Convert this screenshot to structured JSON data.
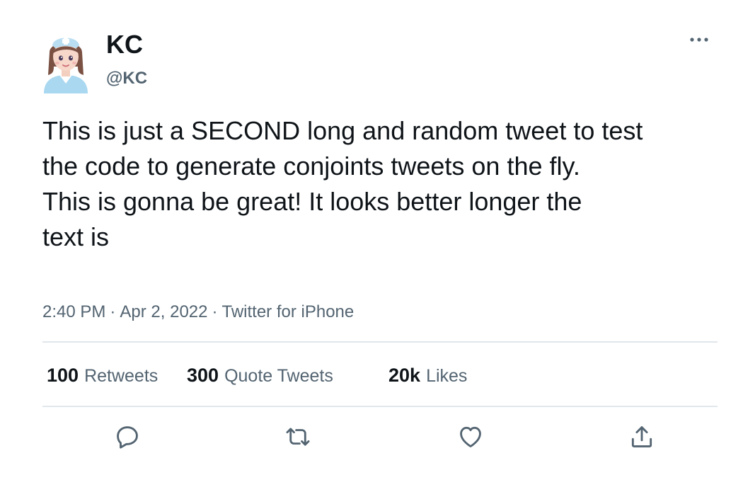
{
  "author": {
    "display_name": "KC",
    "handle": "@KC",
    "avatar_icon": "nurse-avatar-icon"
  },
  "menu_icon": "more-dots-icon",
  "tweet": {
    "text": "This is just a SECOND long and random tweet to test\nthe code to generate conjoints tweets on the fly.\nThis is gonna be great! It looks better longer the\ntext is",
    "time": "2:40 PM",
    "date": "Apr 2, 2022",
    "source": "Twitter for iPhone",
    "separator": "·"
  },
  "stats": {
    "retweets": {
      "count": "100",
      "label": "Retweets"
    },
    "quote_tweets": {
      "count": "300",
      "label": "Quote Tweets"
    },
    "likes": {
      "count": "20k",
      "label": "Likes"
    }
  },
  "actions": [
    {
      "name": "reply",
      "icon": "reply-icon"
    },
    {
      "name": "retweet",
      "icon": "retweet-icon"
    },
    {
      "name": "like",
      "icon": "heart-icon"
    },
    {
      "name": "share",
      "icon": "share-icon"
    }
  ],
  "colors": {
    "text_primary": "#0f1419",
    "text_secondary": "#536471",
    "divider": "#e1e6ea",
    "avatar_skin": "#f6d7c9",
    "avatar_uniform": "#9fd3ef"
  }
}
